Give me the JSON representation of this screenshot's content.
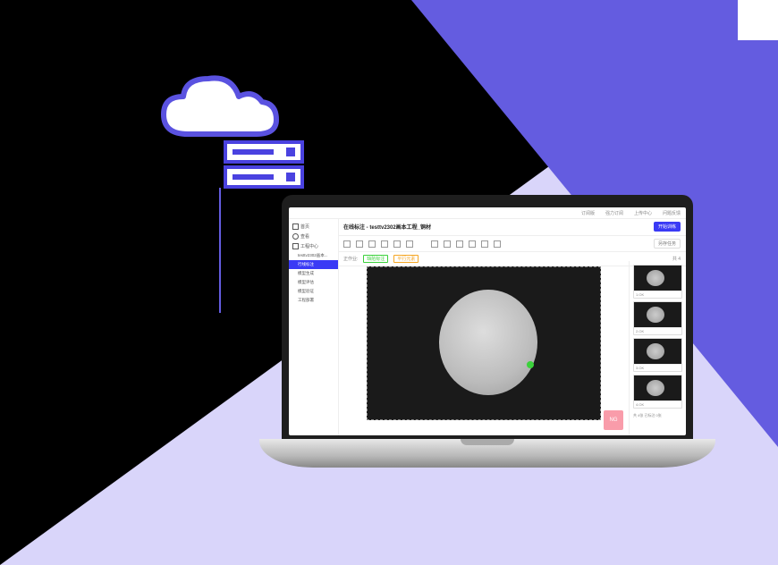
{
  "topbar": {
    "items": [
      "订阅版",
      "强力订阅",
      "上传中心",
      "问题反馈"
    ]
  },
  "sidebar": {
    "items": [
      {
        "icon": "home",
        "label": "首页"
      },
      {
        "icon": "page",
        "label": "查看"
      },
      {
        "icon": "grid",
        "label": "工程中心"
      },
      {
        "icon": "",
        "label": "testtv2302画本..."
      },
      {
        "icon": "",
        "label": "行线标注",
        "active": true
      },
      {
        "icon": "",
        "label": "模型生成"
      },
      {
        "icon": "",
        "label": "模型评估"
      },
      {
        "icon": "",
        "label": "模型验证"
      },
      {
        "icon": "",
        "label": "工程部署"
      }
    ]
  },
  "title": "在线标注 - testtv2302画本工程_铜材",
  "title_right_btn": "开始训练",
  "toolbar": {
    "option_btn": "另存任务",
    "icons": [
      "undo",
      "redo",
      "delete",
      "frame",
      "ocr",
      "text",
      "fit",
      "more",
      "arrow",
      "curve",
      "export",
      "link"
    ]
  },
  "tagbar": {
    "left_label": "正作业:",
    "tags": [
      "缺陷标注",
      "平行元素"
    ],
    "count": "共 4"
  },
  "ng_badge": "NG",
  "thumbs": [
    {
      "label": "1.OK"
    },
    {
      "label": "2.OK"
    },
    {
      "label": "3.OK"
    },
    {
      "label": "4.OK"
    }
  ],
  "thumb_footer": "共 4张   已标注 0张"
}
